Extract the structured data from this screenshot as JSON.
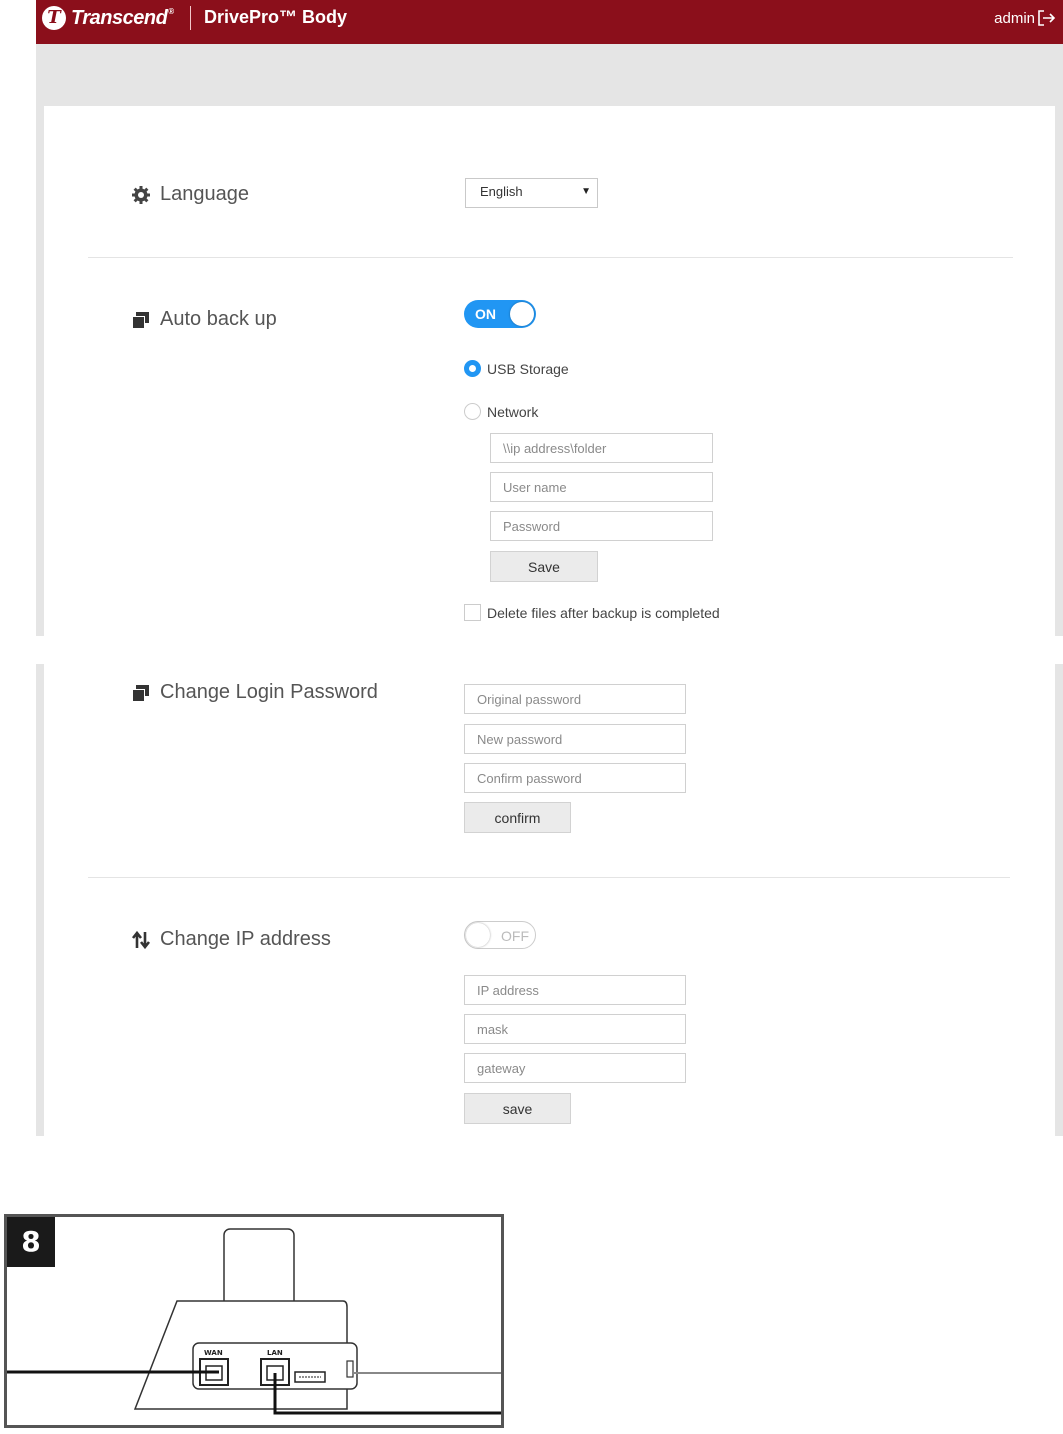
{
  "header": {
    "brand": "Transcend",
    "product": "DrivePro™ Body",
    "user": "admin"
  },
  "language": {
    "label": "Language",
    "selected": "English"
  },
  "auto_backup": {
    "label": "Auto back up",
    "toggle_label": "ON",
    "options": [
      "USB Storage",
      "Network"
    ],
    "selected": "USB Storage",
    "network_placeholders": {
      "path": "\\\\ip address\\folder",
      "user": "User name",
      "password": "Password"
    },
    "save_label": "Save",
    "delete_after_label": "Delete files after backup is completed"
  },
  "login_password": {
    "label": "Change Login Password",
    "placeholders": {
      "original": "Original password",
      "new": "New password",
      "confirm": "Confirm password"
    },
    "confirm_label": "confirm"
  },
  "ip_address": {
    "label": "Change IP address",
    "toggle_label": "OFF",
    "placeholders": {
      "ip": "IP address",
      "mask": "mask",
      "gateway": "gateway"
    },
    "save_label": "save"
  },
  "figure": {
    "step": "8",
    "ports": [
      "WAN",
      "LAN"
    ]
  },
  "colors": {
    "header": "#8b0f1b",
    "accent": "#2196f3"
  }
}
